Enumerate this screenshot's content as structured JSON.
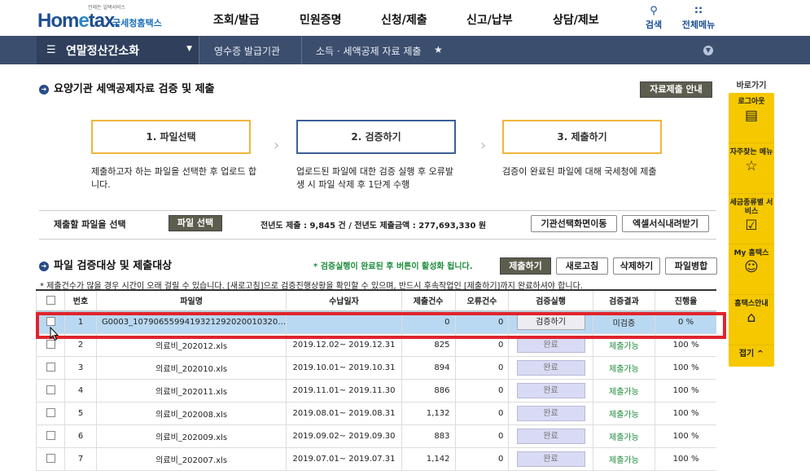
{
  "header": {
    "logo_slogan": "언제든 일택서비스",
    "logo_brand_a": "Hom",
    "logo_brand_b": "e",
    "logo_brand_c": "tax.",
    "logo_korean": "국세청홈택스",
    "nav": [
      "조회/발급",
      "민원증명",
      "신청/제출",
      "신고/납부",
      "상담/제보"
    ],
    "search_label": "검색",
    "allmenu_label": "전체메뉴"
  },
  "subbar": {
    "menu_title": "연말정산간소화",
    "crumbs": [
      "영수증 발급기관",
      "소득 · 세액공제 자료 제출"
    ]
  },
  "quick": {
    "title": "바로가기",
    "items": [
      {
        "label": "로그아웃",
        "icon": "logout-icon"
      },
      {
        "label": "자주찾는 메뉴",
        "icon": "star-icon"
      },
      {
        "label": "세금종류별 서비스",
        "icon": "checkbox-icon"
      },
      {
        "label": "My 홈택스",
        "icon": "person-icon"
      },
      {
        "label": "홈택스안내",
        "icon": "home-icon"
      }
    ],
    "fold": "접기 ^"
  },
  "section1": {
    "title": "요양기관 세액공제자료 검증 및 제출",
    "guide_button": "자료제출 안내",
    "steps": [
      {
        "label": "1. 파일선택",
        "desc": "제출하고자 하는 파일을 선택한 후 업로드 합니다."
      },
      {
        "label": "2. 검증하기",
        "desc": "업로드된 파일에 대한 검증 실행 후 오류발생 시 파일 삭제 후 1단계 수행"
      },
      {
        "label": "3. 제출하기",
        "desc": "검증이 완료된 파일에 대해 국세청에 제출"
      }
    ],
    "select_label": "제출할 파일을 선택",
    "select_button": "파일 선택",
    "prev_year_summary": "전년도 제출 : 9,845 건 / 전년도 제출금액 : 277,693,330 원",
    "org_button": "기관선택화면이동",
    "excel_button": "엑셀서식내려받기"
  },
  "section2": {
    "title": "파일 검증대상 및 제출대상",
    "notice_a": "* 검증실행이 완료된 후 버튼이 활성화 됩니다.",
    "buttons": [
      "제출하기",
      "새로고침",
      "삭제하기",
      "파일병합"
    ],
    "warning": "* 제출건수가 많을 경우 시간이 오래 걸릴 수 있습니다. [새로고침]으로 검증진행상황을 확인할 수 있으며, 반드시 후속작업인 [제출하기]까지 완료하셔야 합니다."
  },
  "table": {
    "headers": [
      "번호",
      "파일명",
      "수납일자",
      "제출건수",
      "오류건수",
      "검증실행",
      "검증결과",
      "진행율"
    ],
    "rows": [
      {
        "no": "1",
        "file": "G0003_1079065599419321292020010320…",
        "date": "",
        "count": "0",
        "errors": "0",
        "action": "검증하기",
        "result": "미검증",
        "progress": "0 %",
        "selected": true
      },
      {
        "no": "2",
        "file": "의료비_202012.xls",
        "date": "2019.12.02~ 2019.12.31",
        "count": "825",
        "errors": "0",
        "action": "완료",
        "result": "제출가능",
        "progress": "100 %",
        "selected": false
      },
      {
        "no": "3",
        "file": "의료비_202010.xls",
        "date": "2019.10.01~ 2019.10.31",
        "count": "894",
        "errors": "0",
        "action": "완료",
        "result": "제출가능",
        "progress": "100 %",
        "selected": false
      },
      {
        "no": "4",
        "file": "의료비_202011.xls",
        "date": "2019.11.01~ 2019.11.30",
        "count": "886",
        "errors": "0",
        "action": "완료",
        "result": "제출가능",
        "progress": "100 %",
        "selected": false
      },
      {
        "no": "5",
        "file": "의료비_202008.xls",
        "date": "2019.08.01~ 2019.08.31",
        "count": "1,132",
        "errors": "0",
        "action": "완료",
        "result": "제출가능",
        "progress": "100 %",
        "selected": false
      },
      {
        "no": "6",
        "file": "의료비_202009.xls",
        "date": "2019.09.02~ 2019.09.30",
        "count": "883",
        "errors": "0",
        "action": "완료",
        "result": "제출가능",
        "progress": "100 %",
        "selected": false
      },
      {
        "no": "7",
        "file": "의료비_202007.xls",
        "date": "2019.07.01~ 2019.07.31",
        "count": "1,142",
        "errors": "0",
        "action": "완료",
        "result": "제출가능",
        "progress": "100 %",
        "selected": false
      }
    ]
  },
  "colors": {
    "navy": "#3c4e6e",
    "accent_yellow": "#f5c800",
    "highlight_red": "#e0242c",
    "ok_green": "#1b8c3a"
  }
}
